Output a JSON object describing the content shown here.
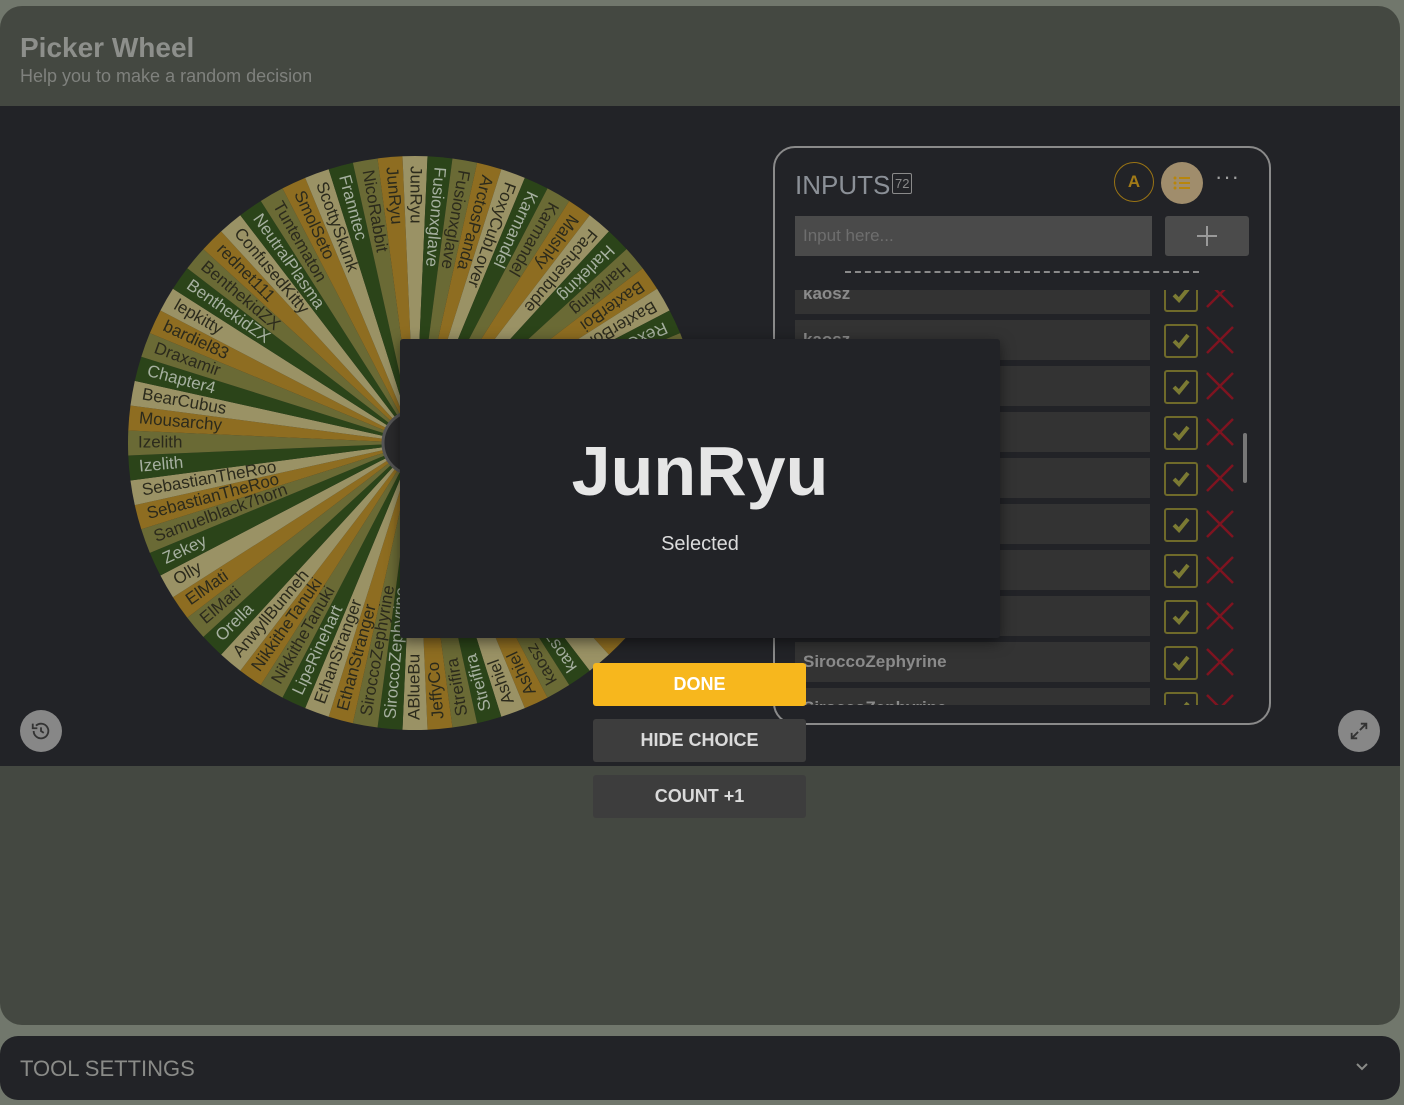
{
  "header": {
    "title": "Picker Wheel",
    "subtitle": "Help you to make a random decision"
  },
  "wheel": {
    "slice_count": 72,
    "colors": [
      "#2b4419",
      "#6a6a35",
      "#8e6d21",
      "#9a9265"
    ],
    "text_colors": {
      "light": "#a6b0a0",
      "dark": "#2b2a1c"
    },
    "labels_by_angle": {
      "55": "kaosz",
      "60": "kaosz",
      "65": "Ashiel",
      "70": "Ashiel",
      "75": "Streifira",
      "80": "Streifira",
      "85": "JeffyCo",
      "90": "ABlueBu",
      "95": "SiroccoZephyrine",
      "100": "SiroccoZephyrine",
      "105": "EthanStranger",
      "110": "EthanStranger",
      "115": "LipeRinehart",
      "120": "NikkitheTanuki",
      "125": "NikkitheTanuki",
      "130": "AnwyllBunneh",
      "135": "Orella",
      "140": "ElMati",
      "145": "ElMati",
      "150": "Olly",
      "155": "Zekey",
      "160": "Samuelblack7horn",
      "165": "SebastianTheRoo",
      "170": "SebastianTheRoo",
      "175": "Izelith",
      "180": "Izelith",
      "185": "Mousarchy",
      "190": "BearCubus",
      "195": "Chapter4",
      "200": "Draxamir",
      "205": "bardiel83",
      "210": "lepkitty",
      "215": "BenthekidZX",
      "220": "BenthekidZX",
      "225": "rednet111",
      "230": "ConfusedKitty",
      "235": "NeutralPlasma",
      "240": "Tuntematon",
      "245": "SmolSeto",
      "250": "ScottySkunk",
      "255": "Franntec",
      "260": "NicoRabbit",
      "265": "JunRyu",
      "270": "JunRyu",
      "275": "Fusionxglave",
      "280": "Fusionxglave",
      "285": "ArctosPanda",
      "290": "FoxyCubLover",
      "295": "Karmandel",
      "300": "Karmandel",
      "305": "Malshky",
      "310": "Fachsenbude",
      "315": "Harleking",
      "320": "Harleking",
      "325": "BaxterBoi",
      "330": "BaxterBoi",
      "335": "RexOtter"
    }
  },
  "inputs": {
    "title": "INPUTS",
    "count": "72",
    "sort_label": "A",
    "more_label": "···",
    "placeholder": "Input here...",
    "rows": [
      "kaosz",
      "kaosz",
      "",
      "",
      "",
      "",
      "",
      "",
      "SiroccoZephyrine",
      "SiroccoZephyrine"
    ]
  },
  "result": {
    "winner": "JunRyu",
    "caption": "Selected"
  },
  "actions": {
    "done": "DONE",
    "hide": "HIDE CHOICE",
    "count": "COUNT +1"
  },
  "tool_settings": {
    "label": "TOOL SETTINGS"
  },
  "colors": {
    "accent": "#f7b71d",
    "check": "#7b7a33",
    "delete": "#7e1420"
  }
}
